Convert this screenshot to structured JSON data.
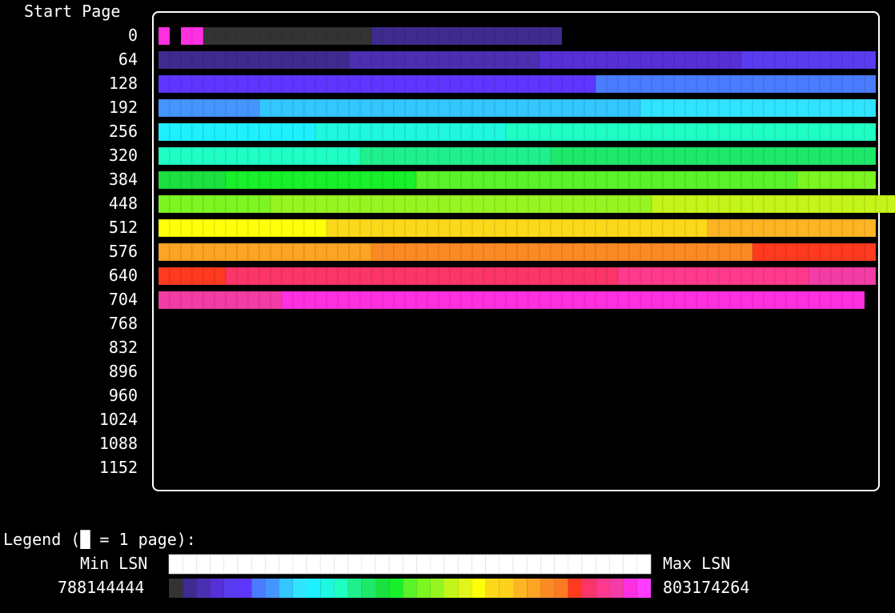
{
  "header": {
    "title": "Start Page"
  },
  "row_labels": [
    "0",
    "64",
    "128",
    "192",
    "256",
    "320",
    "384",
    "448",
    "512",
    "576",
    "640",
    "704",
    "768",
    "832",
    "896",
    "960",
    "1024",
    "1088",
    "1152"
  ],
  "chart_data": {
    "type": "heatmap",
    "pages_per_row": 64,
    "y_label": "Start Page",
    "colormap": [
      "#333333",
      "#3f2a8f",
      "#4a2fb0",
      "#5530d6",
      "#5a3cf0",
      "#5d36ff",
      "#4a7cff",
      "#4595ff",
      "#33c6ff",
      "#30e4ff",
      "#1ef0ff",
      "#1ff7e0",
      "#1fffc4",
      "#20f08c",
      "#1ee86a",
      "#1be040",
      "#17f02a",
      "#5af22a",
      "#7cf520",
      "#96f520",
      "#c4f51a",
      "#e0f51a",
      "#ffff0a",
      "#fbd91a",
      "#fed21c",
      "#feb524",
      "#fda424",
      "#fc8a24",
      "#fc7a24",
      "#ff3a1f",
      "#fc3569",
      "#ff3a8c",
      "#f33ca6",
      "#ff30e0",
      "#ff3cff"
    ],
    "rows": [
      [
        [
          1,
          33
        ],
        [
          1,
          null
        ],
        [
          2,
          33
        ],
        [
          15,
          0
        ],
        [
          17,
          1
        ]
      ],
      [
        [
          17,
          1
        ],
        [
          17,
          2
        ],
        [
          18,
          3
        ],
        [
          12,
          4
        ],
        [
          0,
          5
        ]
      ],
      [
        [
          39,
          5
        ],
        [
          25,
          6
        ]
      ],
      [
        [
          9,
          7
        ],
        [
          17,
          8
        ],
        [
          17,
          8
        ],
        [
          21,
          9
        ]
      ],
      [
        [
          14,
          10
        ],
        [
          17,
          11
        ],
        [
          33,
          12
        ]
      ],
      [
        [
          18,
          12
        ],
        [
          17,
          13
        ],
        [
          29,
          14
        ]
      ],
      [
        [
          6,
          15
        ],
        [
          17,
          16
        ],
        [
          34,
          17
        ],
        [
          7,
          18
        ]
      ],
      [
        [
          10,
          18
        ],
        [
          17,
          19
        ],
        [
          17,
          19
        ],
        [
          34,
          20
        ],
        [
          3,
          22
        ]
      ],
      [
        [
          15,
          22
        ],
        [
          34,
          23
        ],
        [
          15,
          25
        ]
      ],
      [
        [
          2,
          26
        ],
        [
          17,
          26
        ],
        [
          34,
          27
        ],
        [
          11,
          29
        ]
      ],
      [
        [
          6,
          29
        ],
        [
          35,
          30
        ],
        [
          17,
          31
        ],
        [
          6,
          32
        ]
      ],
      [
        [
          11,
          32
        ],
        [
          52,
          33
        ]
      ]
    ],
    "legend": {
      "title": "Legend (█ = 1 page):",
      "min_label": "Min LSN",
      "max_label": "Max LSN",
      "min_value": "788144444",
      "max_value": "803174264"
    }
  }
}
